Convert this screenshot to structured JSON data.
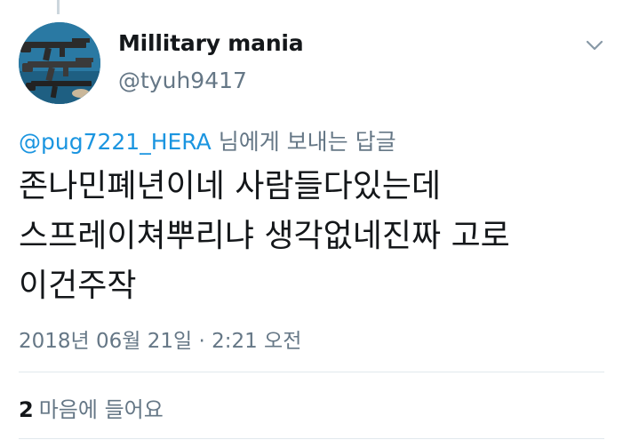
{
  "tweet": {
    "display_name": "Millitary mania",
    "handle": "@tyuh9417",
    "reply_to_handle": "@pug7221_HERA",
    "reply_suffix": " 님에게 보내는 답글",
    "text_lines": [
      "존나민폐년이네 사람들다있는데",
      "스프레이쳐뿌리냐 생각없네진짜 고로",
      "이건주작"
    ],
    "timestamp": "2018년 06월 21일 · 2:21 오전",
    "likes_count": "2",
    "likes_label": "마음에 들어요"
  },
  "icons": {
    "caret": "chevron-down-icon",
    "avatar": "avatar-rifles-image"
  },
  "colors": {
    "link": "#1b95e0",
    "secondary_text": "#657786",
    "primary_text": "#14171a",
    "divider": "#e1e8ed"
  }
}
